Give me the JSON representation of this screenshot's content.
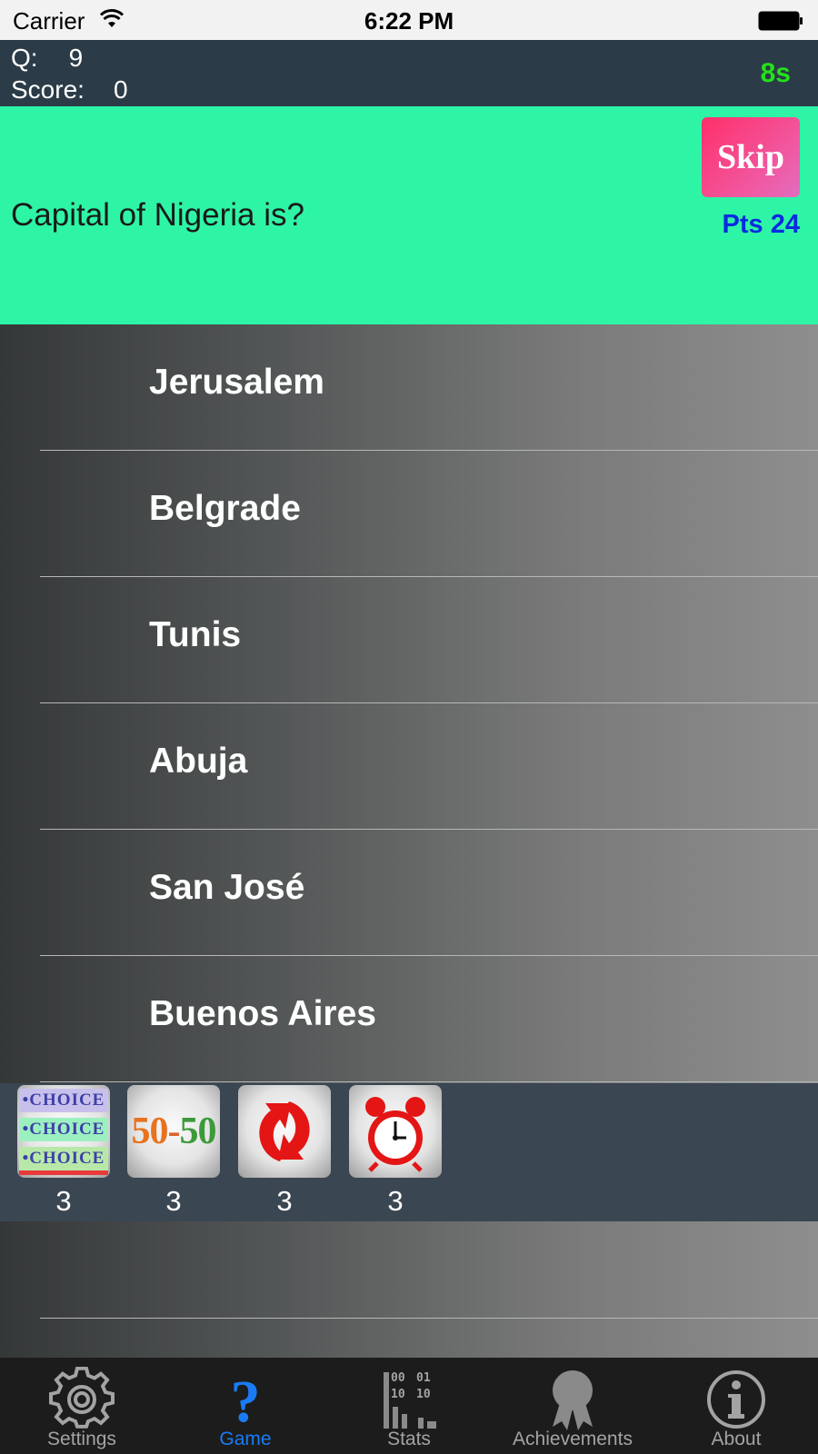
{
  "status_bar": {
    "carrier": "Carrier",
    "time": "6:22 PM"
  },
  "header": {
    "q_label": "Q:",
    "q_value": "9",
    "score_label": "Score:",
    "score_value": "0",
    "timer": "8s"
  },
  "question": {
    "text": "Capital of Nigeria is?",
    "skip_label": "Skip",
    "points": "Pts 24"
  },
  "answers": [
    {
      "label": "Jerusalem"
    },
    {
      "label": "Belgrade"
    },
    {
      "label": "Tunis"
    },
    {
      "label": "Abuja"
    },
    {
      "label": "San José"
    },
    {
      "label": "Buenos Aires"
    }
  ],
  "lifelines": [
    {
      "name": "choice",
      "icon": "three-choices-icon",
      "icon_text": "•CHOICE",
      "count": "3"
    },
    {
      "name": "fifty-fifty",
      "icon": "fifty-fifty-icon",
      "icon_text": "50-50",
      "count": "3"
    },
    {
      "name": "swap",
      "icon": "swap-arrows-icon",
      "count": "3"
    },
    {
      "name": "time",
      "icon": "alarm-clock-icon",
      "count": "3"
    }
  ],
  "tabs": [
    {
      "label": "Settings",
      "icon": "gear-icon",
      "active": false
    },
    {
      "label": "Game",
      "icon": "question-mark-icon",
      "active": true
    },
    {
      "label": "Stats",
      "icon": "stats-icon",
      "icon_text": [
        "00",
        "01",
        "10",
        "10"
      ],
      "active": false
    },
    {
      "label": "Achievements",
      "icon": "ribbon-icon",
      "active": false
    },
    {
      "label": "About",
      "icon": "info-icon",
      "active": false
    }
  ],
  "colors": {
    "header_bg": "#2b3c48",
    "question_bg": "#2ef5a5",
    "timer": "#23e21a",
    "points": "#0a2be0",
    "skip_button": "#ff2f6a",
    "tab_active": "#1a7cf5",
    "tab_inactive": "#a3a3a3"
  }
}
